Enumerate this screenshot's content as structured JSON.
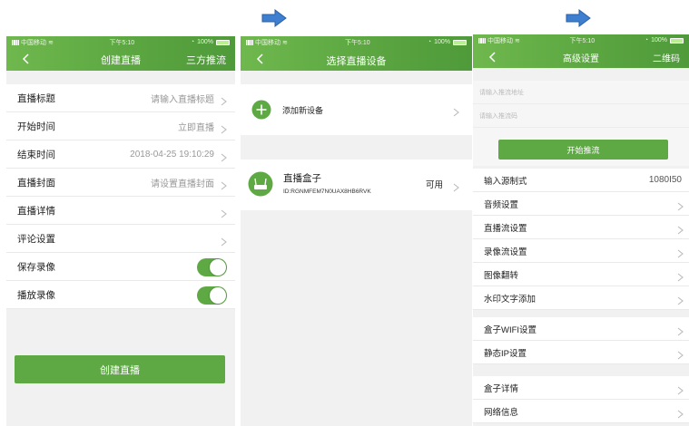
{
  "colors": {
    "brand_green": "#5ea944",
    "arrow_blue": "#3f7fd0"
  },
  "screen1": {
    "status": {
      "carrier": "中国移动",
      "time": "下午5:10",
      "battery": "100%"
    },
    "nav": {
      "title": "创建直播",
      "right": "三方推流",
      "back_icon": "chevron-left-icon"
    },
    "rows": [
      {
        "label": "直播标题",
        "value": "请输入直播标题"
      },
      {
        "label": "开始时间",
        "value": "立即直播"
      },
      {
        "label": "结束时间",
        "value": "2018-04-25 19:10:29"
      },
      {
        "label": "直播封面",
        "value": "请设置直播封面"
      },
      {
        "label": "直播详情",
        "value": ""
      },
      {
        "label": "评论设置",
        "value": ""
      }
    ],
    "toggles": [
      {
        "label": "保存录像",
        "on": true
      },
      {
        "label": "播放录像",
        "on": true
      }
    ],
    "button": "创建直播"
  },
  "screen2": {
    "status": {
      "carrier": "中国移动",
      "time": "下午5:10",
      "battery": "100%"
    },
    "nav": {
      "title": "选择直播设备",
      "back_icon": "chevron-left-icon"
    },
    "add_device": {
      "icon": "plus-circle-icon",
      "label": "添加新设备"
    },
    "device": {
      "icon": "router-icon",
      "name": "直播盒子",
      "id": "ID:RGNMFEM7N0UAX8HB6RVK",
      "status": "可用"
    }
  },
  "screen3": {
    "status": {
      "carrier": "中国移动",
      "time": "下午5:10",
      "battery": "100%"
    },
    "nav": {
      "title": "高级设置",
      "right": "二维码",
      "back_icon": "chevron-left-icon"
    },
    "inputs": [
      {
        "placeholder": "请输入推流地址"
      },
      {
        "placeholder": "请输入推流码"
      }
    ],
    "button": "开始推流",
    "group1": [
      {
        "label": "输入源制式",
        "value": "1080I50"
      },
      {
        "label": "音频设置",
        "value": ""
      },
      {
        "label": "直播流设置",
        "value": ""
      },
      {
        "label": "录像流设置",
        "value": ""
      },
      {
        "label": "图像翻转",
        "value": ""
      },
      {
        "label": "水印文字添加",
        "value": ""
      }
    ],
    "group2": [
      {
        "label": "盒子WIFI设置"
      },
      {
        "label": "静态IP设置"
      }
    ],
    "group3": [
      {
        "label": "盒子详情"
      },
      {
        "label": "网络信息"
      }
    ]
  }
}
